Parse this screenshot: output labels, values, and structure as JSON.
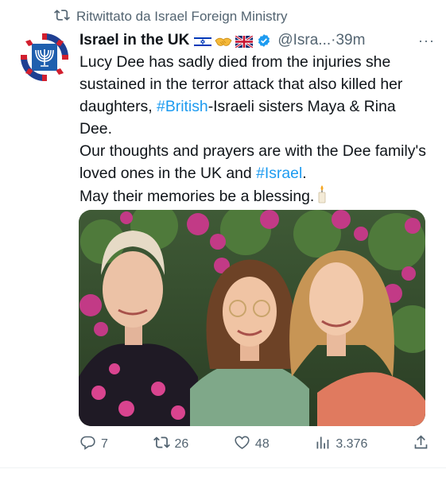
{
  "retweet": {
    "label": "Ritwittato da Israel Foreign Ministry",
    "icon": "retweet-icon"
  },
  "tweet": {
    "author_name": "Israel in the UK",
    "flags": [
      "israel-flag",
      "handshake-emoji",
      "uk-flag"
    ],
    "verified_icon": "verified-badge-icon",
    "handle": "@Isra...",
    "time": "·39m",
    "more": "···",
    "text": {
      "p1_before": "Lucy Dee has sadly died from the injuries she sustained in the terror attack that also killed her daughters, ",
      "p1_tag": "#British",
      "p1_after": "-Israeli sisters Maya & Rina Dee.",
      "p2_before": "Our thoughts and prayers are with the Dee family's loved ones in the UK and ",
      "p2_tag": "#Israel",
      "p2_after": ".",
      "p3": "May their memories be a blessing.",
      "p3_emoji": "candle-emoji"
    },
    "photo_description": "photo-three-women-bougainvillea"
  },
  "actions": {
    "reply": {
      "icon": "reply-icon",
      "count": "7"
    },
    "retweet": {
      "icon": "retweet-icon",
      "count": "26"
    },
    "like": {
      "icon": "heart-icon",
      "count": "48"
    },
    "views": {
      "icon": "views-icon",
      "count": "3.376"
    },
    "share": {
      "icon": "share-icon"
    }
  },
  "colors": {
    "link": "#1d9bf0",
    "secondary": "#536471",
    "verified": "#1d9bf0"
  }
}
